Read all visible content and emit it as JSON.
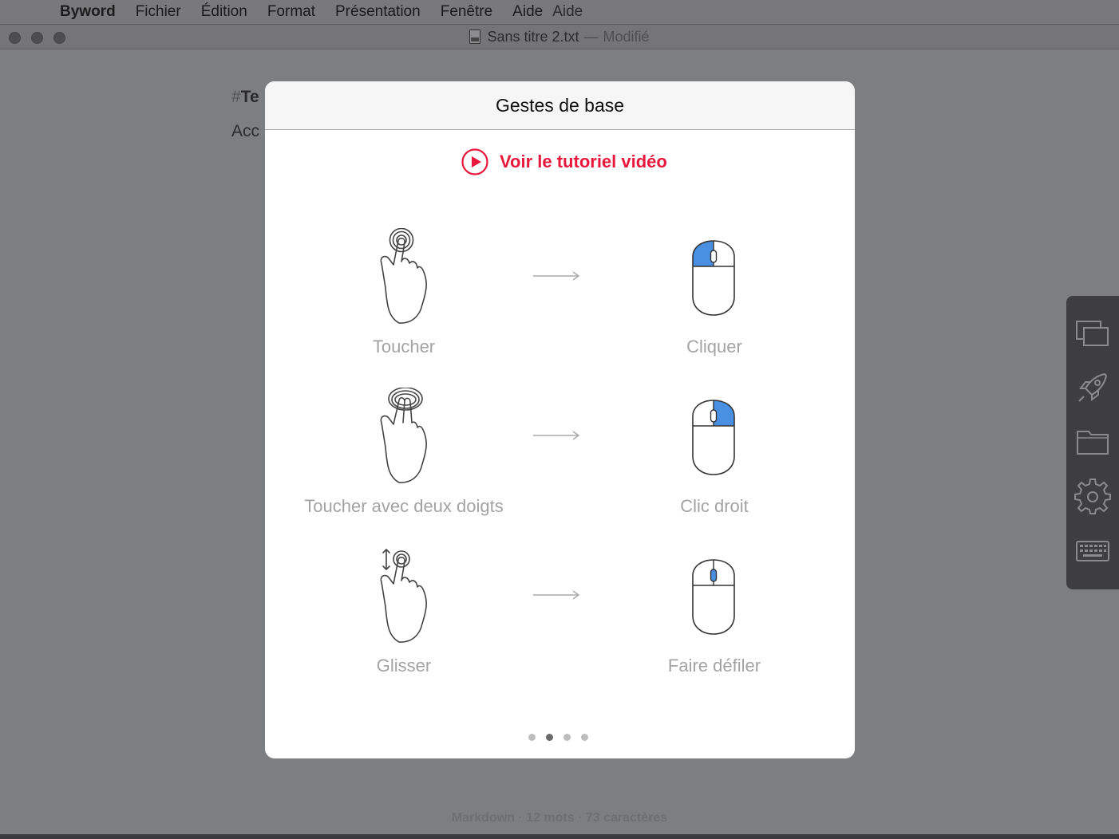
{
  "menubar": {
    "app_name": "Byword",
    "items": [
      "Fichier",
      "Édition",
      "Format",
      "Présentation",
      "Fenêtre",
      "Aide"
    ],
    "overlap_ghost": "Aide"
  },
  "window": {
    "title": "Sans titre 2.txt",
    "separator": "—",
    "status": "Modifié"
  },
  "editor": {
    "line1_hash": "#",
    "line1_text": "Te",
    "line2_text": "Acc"
  },
  "statusbar": {
    "text": "Markdown · 12 mots · 73 caractères"
  },
  "sidepanel": {
    "icons": [
      "windows-icon",
      "rocket-icon",
      "folder-icon",
      "gear-icon",
      "keyboard-icon"
    ]
  },
  "modal": {
    "title": "Gestes de base",
    "video_link": "Voir le tutoriel vidéo",
    "accent_color": "#e8173c",
    "highlight_color": "#4a90e2",
    "gestures": [
      {
        "touch": "Toucher",
        "mouse": "Cliquer"
      },
      {
        "touch": "Toucher avec deux doigts",
        "mouse": "Clic droit"
      },
      {
        "touch": "Glisser",
        "mouse": "Faire défiler"
      }
    ],
    "page_count": 4,
    "current_page": 2
  }
}
